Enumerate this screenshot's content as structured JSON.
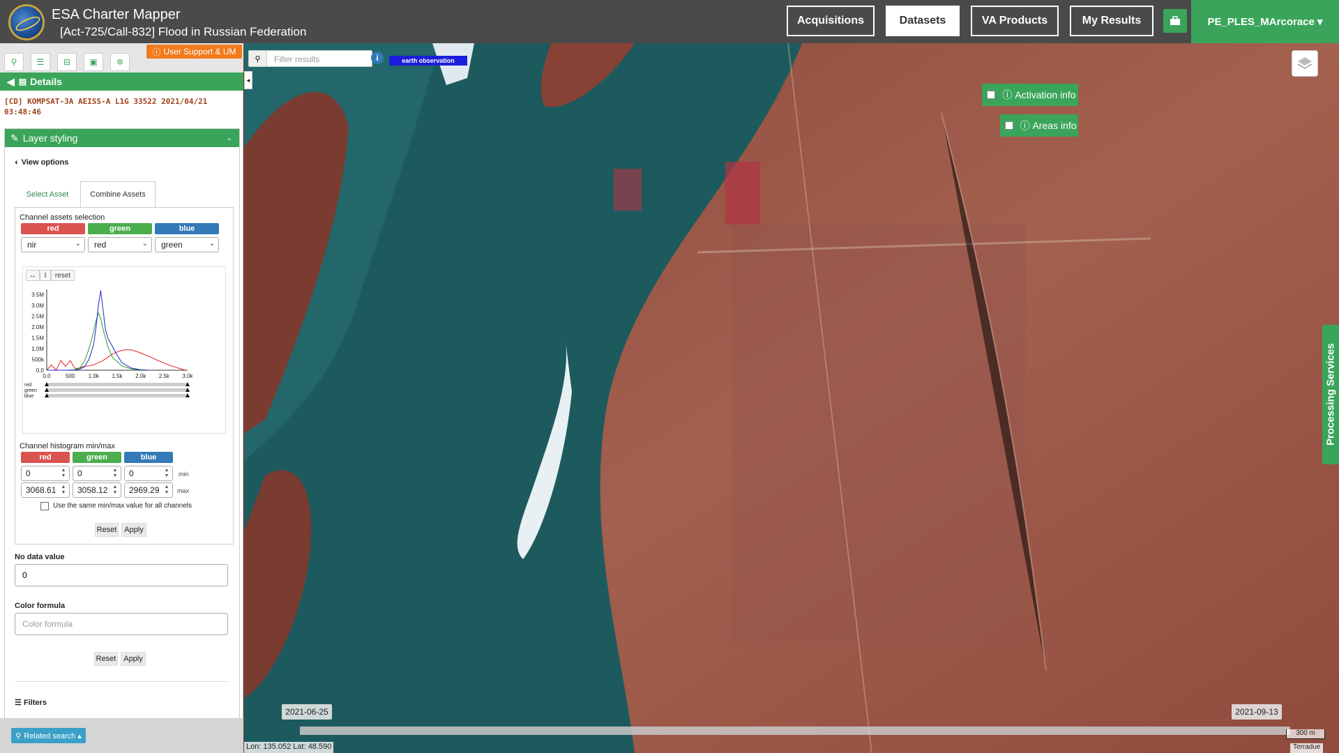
{
  "header": {
    "app_title": "ESA Charter Mapper",
    "subtitle": "[Act-725/Call-832] Flood in Russian Federation",
    "nav": [
      "Acquisitions",
      "Datasets",
      "VA Products",
      "My Results"
    ],
    "active_nav": "Datasets",
    "user": "PE_PLES_MArcorace ▾",
    "accent_color": "#3aa55a"
  },
  "left": {
    "support_label": "User Support & UM",
    "details_label": "Details",
    "product_name": "[CD] KOMPSAT-3A AEISS-A L1G 33522 2021/04/21 03:48:46",
    "layer_styling_label": "Layer styling",
    "view_options_label": "View options",
    "tabs": [
      "Select Asset",
      "Combine Assets"
    ],
    "channel_assets_label": "Channel assets selection",
    "channels": [
      "red",
      "green",
      "blue"
    ],
    "channel_selects": [
      "nir",
      "red",
      "green"
    ],
    "histo_controls": [
      "↔",
      "I",
      "reset"
    ],
    "histo_min_max_label": "Channel histogram min/max",
    "min_values": [
      "0",
      "0",
      "0"
    ],
    "max_values": [
      "3068.61",
      "3058.12",
      "2969.29"
    ],
    "min_label": "min",
    "max_label": "max",
    "same_minmax_label": "Use the same min/max value for all channels",
    "reset_label": "Reset",
    "apply_label": "Apply",
    "no_data_label": "No data value",
    "no_data_value": "0",
    "color_formula_label": "Color formula",
    "color_formula_placeholder": "Color formula",
    "filters_label": "Filters",
    "related_search_label": "Related search ▴"
  },
  "chart_data": {
    "type": "line",
    "y_ticks": [
      "3.5M",
      "3.0M",
      "2.5M",
      "2.0M",
      "1.5M",
      "1.0M",
      "500k",
      "0.0"
    ],
    "x_ticks": [
      "0.0",
      "500",
      "1.0k",
      "1.5k",
      "2.0k",
      "2.5k",
      "3.0k"
    ],
    "xlim": [
      0,
      3000
    ],
    "ylim": [
      0,
      3750000
    ],
    "slider_labels": [
      "red",
      "green",
      "blue"
    ],
    "series": [
      {
        "name": "red",
        "color": "#e02020",
        "x": [
          0,
          100,
          200,
          300,
          400,
          500,
          600,
          700,
          800,
          900,
          1000,
          1100,
          1200,
          1300,
          1400,
          1500,
          1600,
          1700,
          1800,
          1900,
          2000,
          2200,
          2400,
          2600,
          2800,
          2950
        ],
        "y": [
          0,
          250000,
          0,
          450000,
          180000,
          450000,
          80000,
          100000,
          180000,
          200000,
          250000,
          350000,
          450000,
          600000,
          750000,
          850000,
          920000,
          950000,
          940000,
          880000,
          800000,
          620000,
          420000,
          240000,
          100000,
          0
        ]
      },
      {
        "name": "green",
        "color": "#20a020",
        "x": [
          0,
          200,
          400,
          600,
          700,
          800,
          900,
          1000,
          1050,
          1100,
          1150,
          1200,
          1300,
          1400,
          1600,
          1800,
          2000,
          2200
        ],
        "y": [
          0,
          0,
          0,
          20000,
          100000,
          400000,
          1000000,
          1800000,
          2300000,
          2650000,
          2400000,
          1900000,
          1100000,
          600000,
          200000,
          60000,
          10000,
          0
        ]
      },
      {
        "name": "blue",
        "color": "#2020d0",
        "x": [
          0,
          200,
          400,
          600,
          700,
          800,
          900,
          1000,
          1050,
          1100,
          1150,
          1200,
          1250,
          1300,
          1400,
          1500,
          1600,
          1800,
          2000,
          2200
        ],
        "y": [
          0,
          0,
          0,
          10000,
          50000,
          150000,
          500000,
          1200000,
          2000000,
          3000000,
          3700000,
          2800000,
          1900000,
          1500000,
          1100000,
          700000,
          350000,
          100000,
          20000,
          0
        ]
      }
    ]
  },
  "map": {
    "filter_placeholder": "Filter results",
    "eo_tag": "earth observation",
    "activation_info": "Activation info",
    "areas_info": "Areas info",
    "processing_services": "Processing Services",
    "date_start": "2021-06-25",
    "date_end": "2021-09-13",
    "coords": "Lon: 135.052 Lat: 48.590",
    "scale": "300 m",
    "attribution": "Terradue"
  }
}
